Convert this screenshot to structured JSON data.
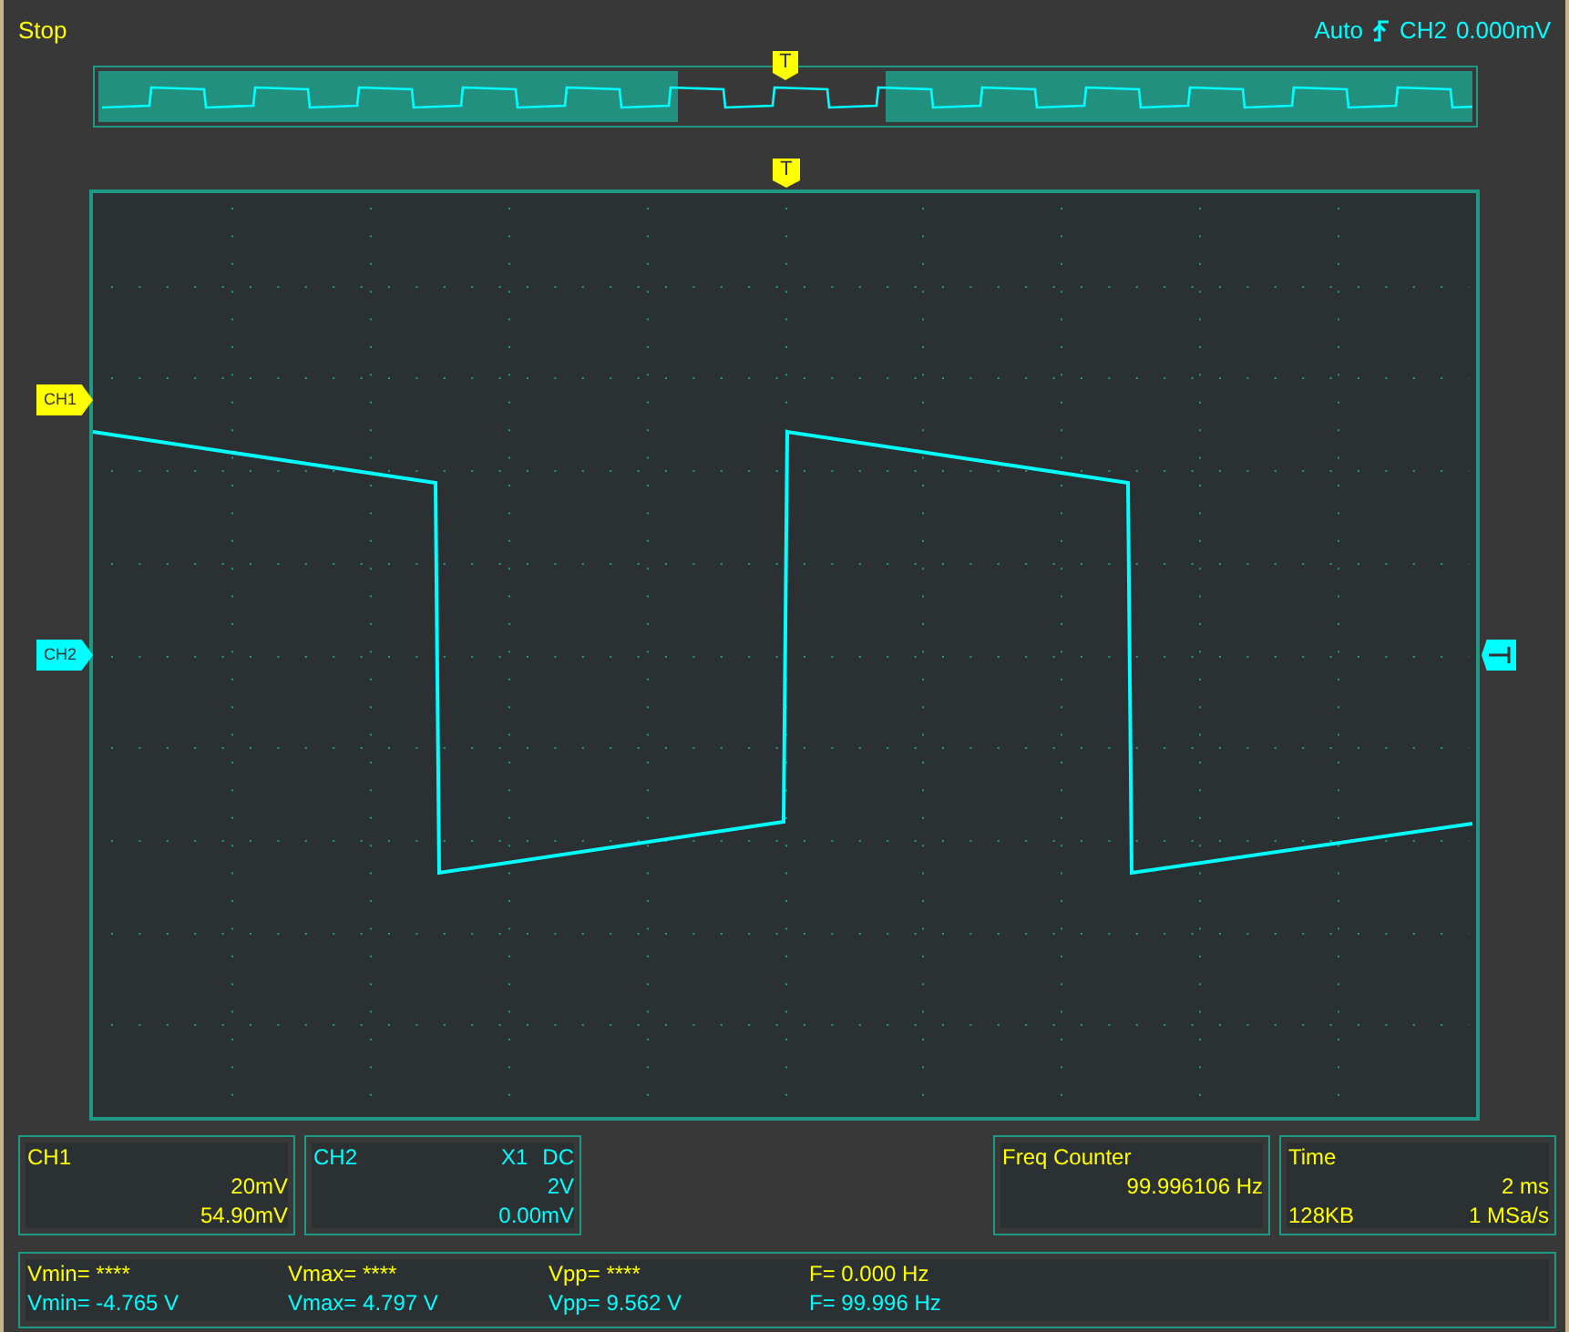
{
  "status": "Stop",
  "trigger": {
    "mode": "Auto",
    "source": "CH2",
    "level": "0.000mV",
    "marker": "T"
  },
  "overview": {
    "trigger_marker": "T"
  },
  "channels": [
    {
      "name": "CH1",
      "marker_label": "CH1",
      "scale": "20mV",
      "offset": "54.90mV",
      "color": "#ffff00"
    },
    {
      "name": "CH2",
      "marker_label": "CH2",
      "probe": "X1",
      "coupling": "DC",
      "scale": "2V",
      "offset": "0.00mV",
      "color": "#00ffff"
    }
  ],
  "freq_counter": {
    "title": "Freq Counter",
    "value": "99.996106 Hz"
  },
  "time": {
    "title": "Time",
    "scale": "2 ms",
    "memory": "128KB",
    "sample_rate": "1 MSa/s"
  },
  "measurements": [
    {
      "color": "#ffff00",
      "values": [
        "Vmin= ****",
        "Vmax= ****",
        "Vpp= ****",
        "F= 0.000 Hz"
      ]
    },
    {
      "color": "#00ffff",
      "values": [
        "Vmin= -4.765 V",
        "Vmax= 4.797 V",
        "Vpp= 9.562 V",
        "F= 99.996 Hz"
      ]
    }
  ]
}
